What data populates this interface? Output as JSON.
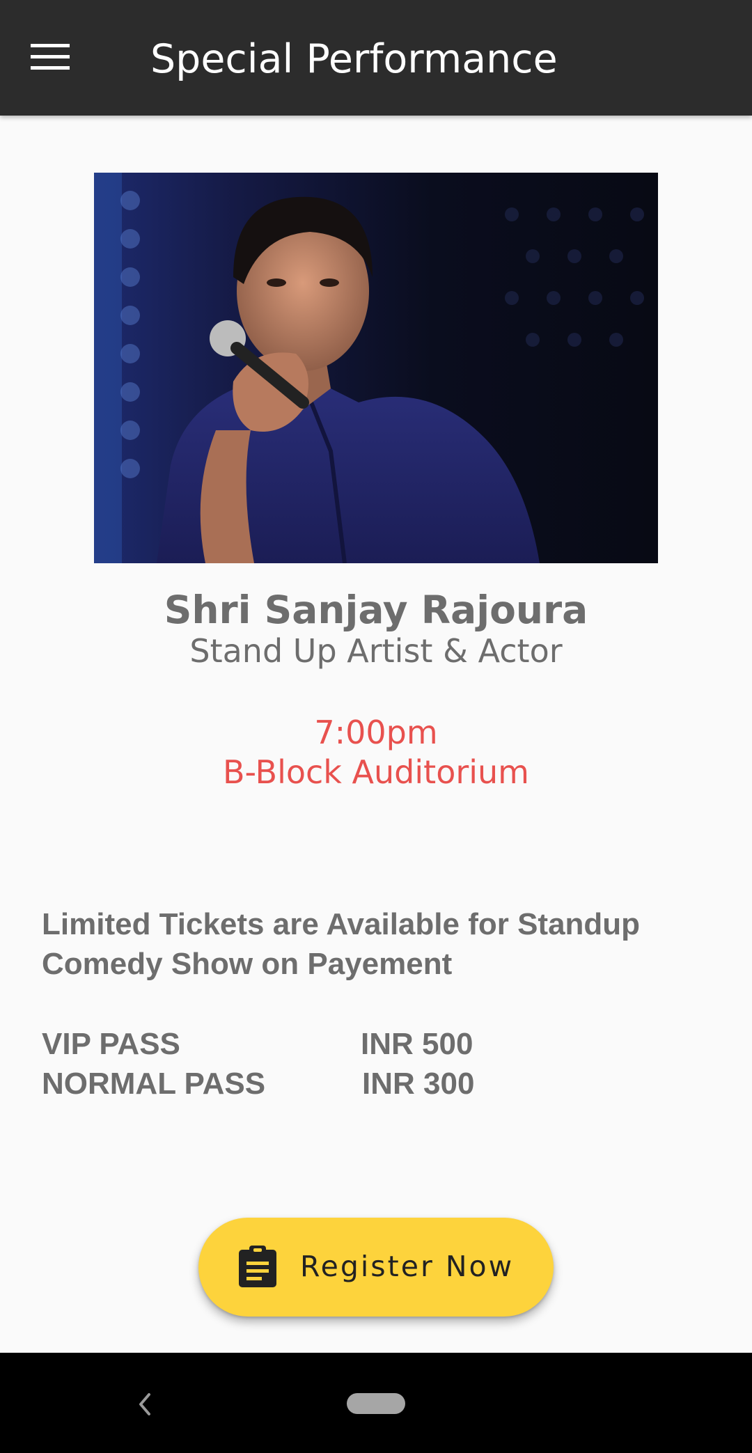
{
  "app_bar": {
    "title": "Special Performance",
    "menu_icon": "hamburger-menu-icon",
    "background_color": "#2c2c2c"
  },
  "artist": {
    "name": "Shri Sanjay Rajoura",
    "role": "Stand Up Artist & Actor",
    "photo": "performer-with-microphone-photo"
  },
  "event": {
    "time": "7:00pm",
    "venue": "B-Block Auditorium",
    "accent_color": "#e8514e"
  },
  "tickets": {
    "note": "Limited Tickets are Available for Standup Comedy Show on Payement",
    "passes": [
      {
        "name": "VIP PASS",
        "price": "INR 500"
      },
      {
        "name": "NORMAL PASS",
        "price": "INR 300"
      }
    ]
  },
  "register_button": {
    "label": "Register Now",
    "icon": "clipboard-icon",
    "color": "#fdd33c"
  },
  "system_nav": {
    "back_icon": "back-chevron-icon",
    "home_icon": "home-pill-icon"
  }
}
